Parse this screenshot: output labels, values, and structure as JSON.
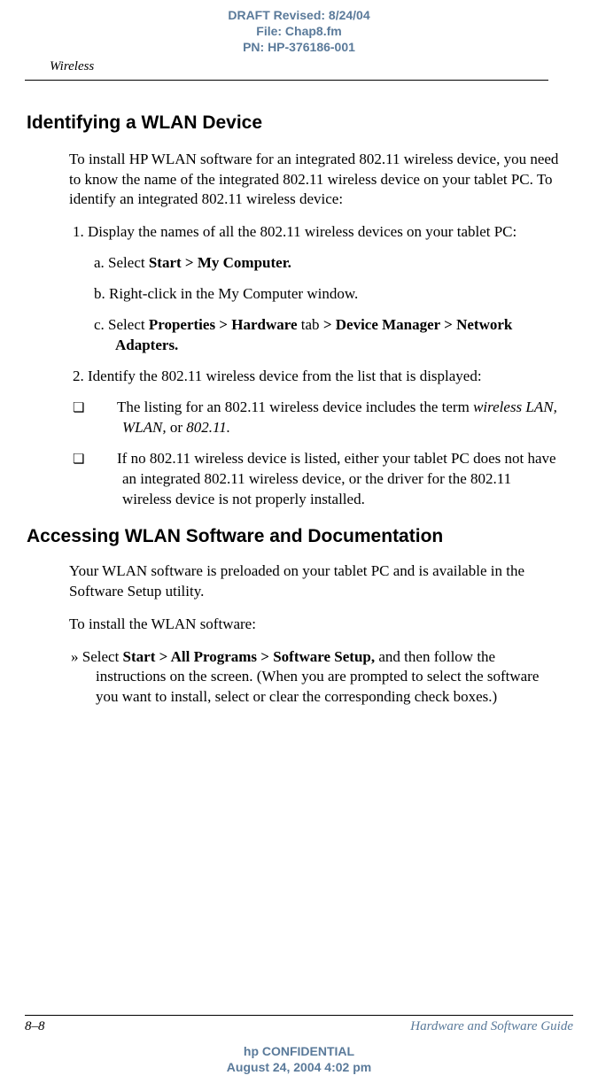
{
  "header": {
    "draft_line": "DRAFT Revised: 8/24/04",
    "file_line": "File: Chap8.fm",
    "pn_line": "PN: HP-376186-001",
    "section_label": "Wireless"
  },
  "section1": {
    "heading": "Identifying a WLAN Device",
    "intro": "To install HP WLAN software for an integrated 802.11 wireless device, you need to know the name of the integrated 802.11 wireless device on your tablet PC. To identify an integrated 802.11 wireless device:",
    "step1": "1. Display the names of all the 802.11 wireless devices on your tablet PC:",
    "step1a_prefix": "a.   Select ",
    "step1a_bold": "Start > My Computer.",
    "step1b": "b.   Right-click in the My Computer window.",
    "step1c_prefix": "c.   Select ",
    "step1c_bold1": "Properties > Hardware",
    "step1c_mid": " tab ",
    "step1c_bold2": "> Device Manager > Network Adapters.",
    "step2": "2. Identify the 802.11 wireless device from the list that is displayed:",
    "bullet1_pre": "The listing for an 802.11 wireless device includes the term ",
    "bullet1_italic": "wireless LAN, WLAN,",
    "bullet1_mid": " or ",
    "bullet1_italic2": "802.11.",
    "bullet2": "If no 802.11 wireless device is listed, either your tablet PC does not have an integrated 802.11 wireless device, or the driver for the 802.11 wireless device is not properly installed."
  },
  "section2": {
    "heading": "Accessing WLAN Software and Documentation",
    "para1": "Your WLAN software is preloaded on your tablet PC and is available in the Software Setup utility.",
    "para2": "To install the WLAN software:",
    "action_prefix": "»    Select ",
    "action_bold": "Start > All Programs > Software Setup,",
    "action_rest": " and then follow the instructions on the screen. (When you are prompted to select the software you want to install, select or clear the corresponding check boxes.)"
  },
  "footer": {
    "page": "8–8",
    "guide": "Hardware and Software Guide",
    "conf_line": "hp CONFIDENTIAL",
    "date_line": "August 24, 2004 4:02 pm"
  }
}
